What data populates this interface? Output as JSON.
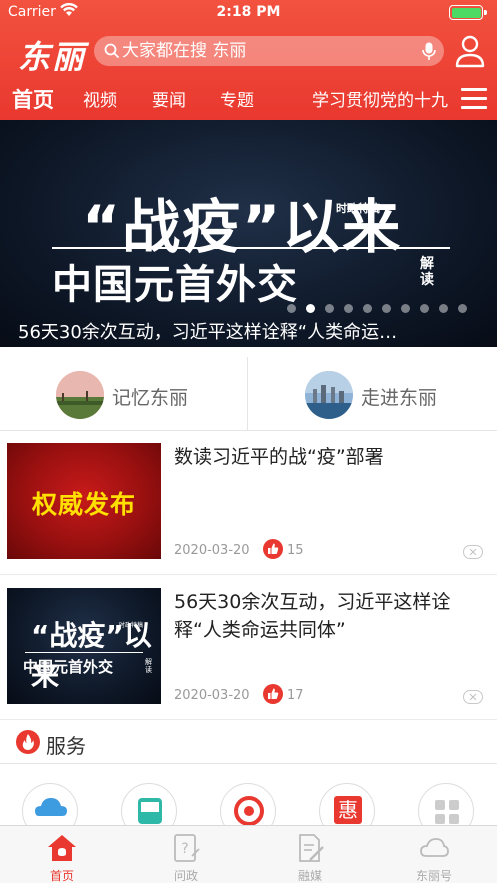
{
  "status_bar": {
    "carrier": "Carrier",
    "time": "2:18 PM"
  },
  "header": {
    "logo": "东丽",
    "search_placeholder": "大家都在搜 东丽",
    "tabs": [
      {
        "label": "首页",
        "active": true
      },
      {
        "label": "视频"
      },
      {
        "label": "要闻"
      },
      {
        "label": "专题"
      },
      {
        "label": "学习贯彻党的十九"
      }
    ]
  },
  "banner": {
    "headline_line1": "“战疫”以来",
    "headline_tag": "时政特稿",
    "headline_line2": "中国元首外交",
    "headline_side": "解读",
    "caption": "56天30余次互动，习近平这样诠释“人类命运…",
    "page_count": 10,
    "current_page": 2
  },
  "quick_links": [
    {
      "label": "记忆东丽"
    },
    {
      "label": "走进东丽"
    }
  ],
  "news": [
    {
      "title": "数读习近平的战“疫”部署",
      "image_text": "权威发布",
      "date": "2020-03-20",
      "likes": "15"
    },
    {
      "title": "56天30余次互动，习近平这样诠释“人类命运共同体”",
      "image_line1": "“战疫”以来",
      "image_tag": "时政特稿",
      "image_line2": "中国元首外交",
      "image_side": "解读",
      "date": "2020-03-20",
      "likes": "17"
    }
  ],
  "services": {
    "title": "服务",
    "items": [
      "cloud-icon",
      "bus-icon",
      "recycle-icon",
      "hui-icon",
      "grid-icon"
    ]
  },
  "tab_bar": [
    {
      "label": "首页",
      "icon": "home-icon",
      "active": true
    },
    {
      "label": "问政",
      "icon": "question-icon"
    },
    {
      "label": "融媒",
      "icon": "edit-icon"
    },
    {
      "label": "东丽号",
      "icon": "cloud-icon"
    }
  ],
  "colors": {
    "accent": "#e9382f",
    "header_top": "#f2523f"
  }
}
